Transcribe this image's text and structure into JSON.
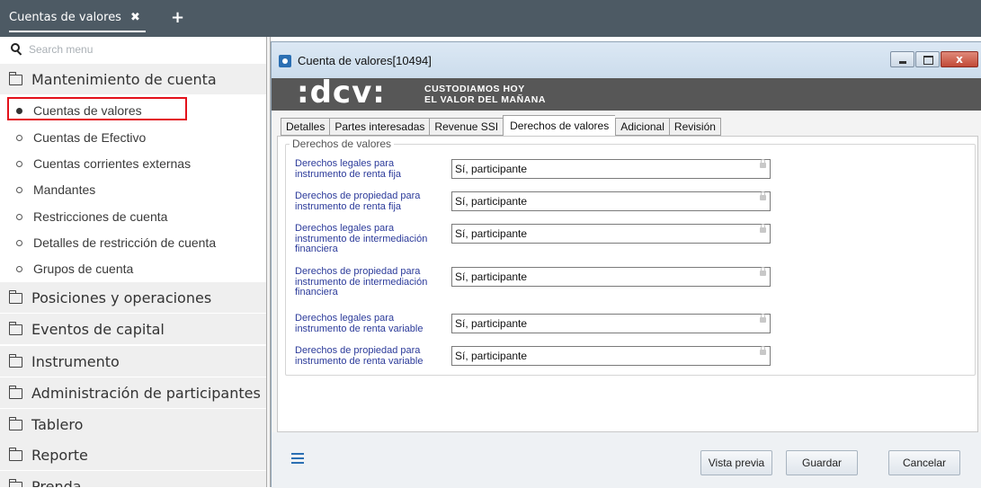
{
  "topbar": {
    "tab_label": "Cuentas de valores",
    "close_glyph": "✖",
    "add_glyph": "+"
  },
  "sidebar": {
    "search_placeholder": "Search menu",
    "sections": [
      {
        "label": "Mantenimiento de cuenta",
        "icon": "folder-open-icon"
      },
      {
        "label": "Posiciones y operaciones",
        "icon": "folder-icon"
      },
      {
        "label": "Eventos de capital",
        "icon": "folder-icon"
      },
      {
        "label": "Instrumento",
        "icon": "folder-icon"
      },
      {
        "label": "Administración de participantes",
        "icon": "folder-icon"
      },
      {
        "label": "Tablero",
        "icon": "folder-icon"
      },
      {
        "label": "Reporte",
        "icon": "folder-icon"
      },
      {
        "label": "Prenda",
        "icon": "folder-icon"
      }
    ],
    "items": [
      {
        "label": "Cuentas de valores",
        "selected": true
      },
      {
        "label": "Cuentas de Efectivo"
      },
      {
        "label": "Cuentas corrientes externas"
      },
      {
        "label": "Mandantes"
      },
      {
        "label": "Restricciones de cuenta"
      },
      {
        "label": "Detalles de restricción de cuenta"
      },
      {
        "label": "Grupos de cuenta"
      }
    ]
  },
  "window": {
    "title": "Cuenta de valores[10494]",
    "logo": ":dcv:",
    "tagline_1": "CUSTODIAMOS HOY",
    "tagline_2": "EL VALOR DEL MAÑANA",
    "close_label": "x",
    "tabs": [
      "Detalles",
      "Partes interesadas",
      "Revenue SSI",
      "Derechos de valores",
      "Adicional",
      "Revisión"
    ],
    "active_tab": "Derechos de valores",
    "group_title": "Derechos de valores",
    "rows": [
      {
        "label": "Derechos legales para instrumento de renta fija",
        "value": "Sí, participante"
      },
      {
        "label": "Derechos de propiedad para instrumento de renta fija",
        "value": "Sí, participante"
      },
      {
        "label": "Derechos legales para instrumento de intermediación financiera",
        "value": "Sí, participante"
      },
      {
        "label": "Derechos de propiedad para instrumento de intermediación financiera",
        "value": "Sí, participante"
      },
      {
        "label": "Derechos legales para instrumento de renta variable",
        "value": "Sí, participante"
      },
      {
        "label": "Derechos de propiedad para instrumento de renta variable",
        "value": "Sí, participante"
      }
    ],
    "buttons": {
      "preview": "Vista previa",
      "save": "Guardar",
      "cancel": "Cancelar"
    }
  },
  "colors": {
    "topbar": "#4d5a64",
    "selection_highlight": "#e3111b",
    "label_text": "#2b3a9a",
    "banner": "#575757"
  }
}
